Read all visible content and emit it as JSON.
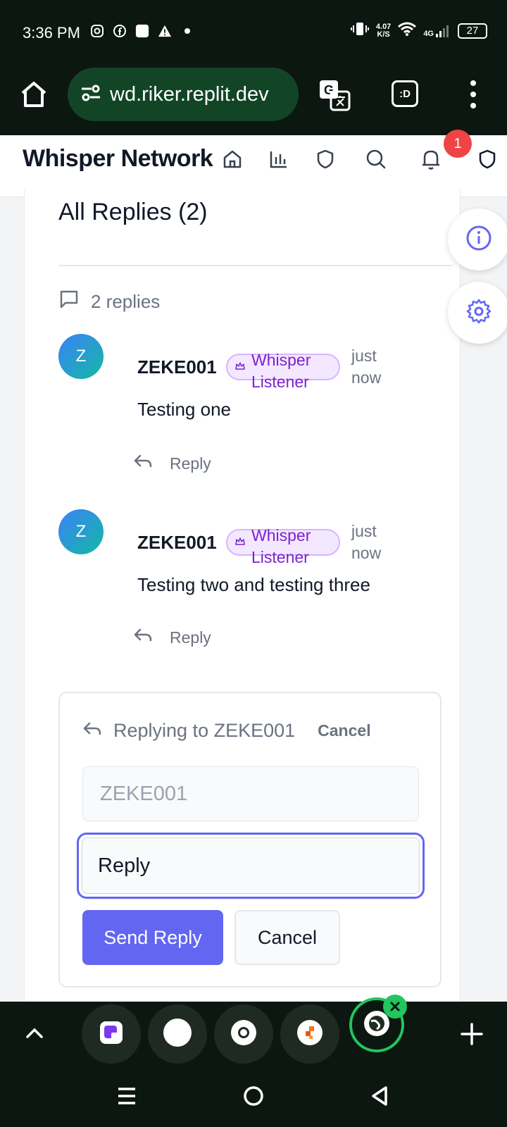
{
  "status": {
    "time": "3:36 PM",
    "net_speed_value": "4.07",
    "net_speed_unit": "K/S",
    "network": "4G",
    "battery": "27"
  },
  "browser": {
    "url": "wd.riker.replit.dev",
    "tab_label": ":D"
  },
  "app": {
    "brand": "Whisper Network",
    "notification_count": "1"
  },
  "replies_section": {
    "title": "All Replies (2)",
    "count_text": "2 replies",
    "items": [
      {
        "avatar_initial": "Z",
        "author": "ZEKE001",
        "role_line1": "Whisper",
        "role_line2": "Listener",
        "time_line1": "just",
        "time_line2": "now",
        "body": "Testing one",
        "reply_label": "Reply"
      },
      {
        "avatar_initial": "Z",
        "author": "ZEKE001",
        "role_line1": "Whisper",
        "role_line2": "Listener",
        "time_line1": "just",
        "time_line2": "now",
        "body": "Testing two and testing three",
        "reply_label": "Reply"
      }
    ]
  },
  "reply_form": {
    "replying_to": "Replying to ZEKE001",
    "cancel_link": "Cancel",
    "name_value": "ZEKE001",
    "reply_placeholder": "Reply",
    "send_label": "Send Reply",
    "cancel_label": "Cancel"
  },
  "colors": {
    "accent": "#6366f1",
    "badge_bg": "#f3e8ff",
    "badge_text": "#7e22ce",
    "notification": "#ef4444",
    "browser_bar": "#0b1710"
  }
}
